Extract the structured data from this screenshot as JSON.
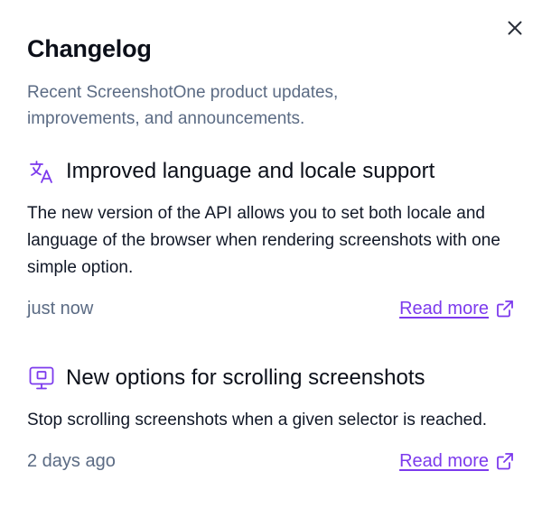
{
  "panel": {
    "title": "Changelog",
    "subtitle": "Recent ScreenshotOne product updates, improvements, and announcements.",
    "close_icon": "close-icon"
  },
  "colors": {
    "accent": "#7c3aed",
    "muted_text": "#5b6b84",
    "heading": "#0b0f19",
    "body_text": "#111827"
  },
  "entries": [
    {
      "icon": "translate-icon",
      "title": "Improved language and locale support",
      "body": "The new version of the API allows you to set both locale and language of the browser when rendering screenshots with one simple option.",
      "time": "just now",
      "link_label": "Read more",
      "link_icon": "external-link-icon"
    },
    {
      "icon": "monitor-icon",
      "title": "New options for scrolling screenshots",
      "body": "Stop scrolling screenshots when a given selector is reached.",
      "time": "2 days ago",
      "link_label": "Read more",
      "link_icon": "external-link-icon"
    }
  ]
}
